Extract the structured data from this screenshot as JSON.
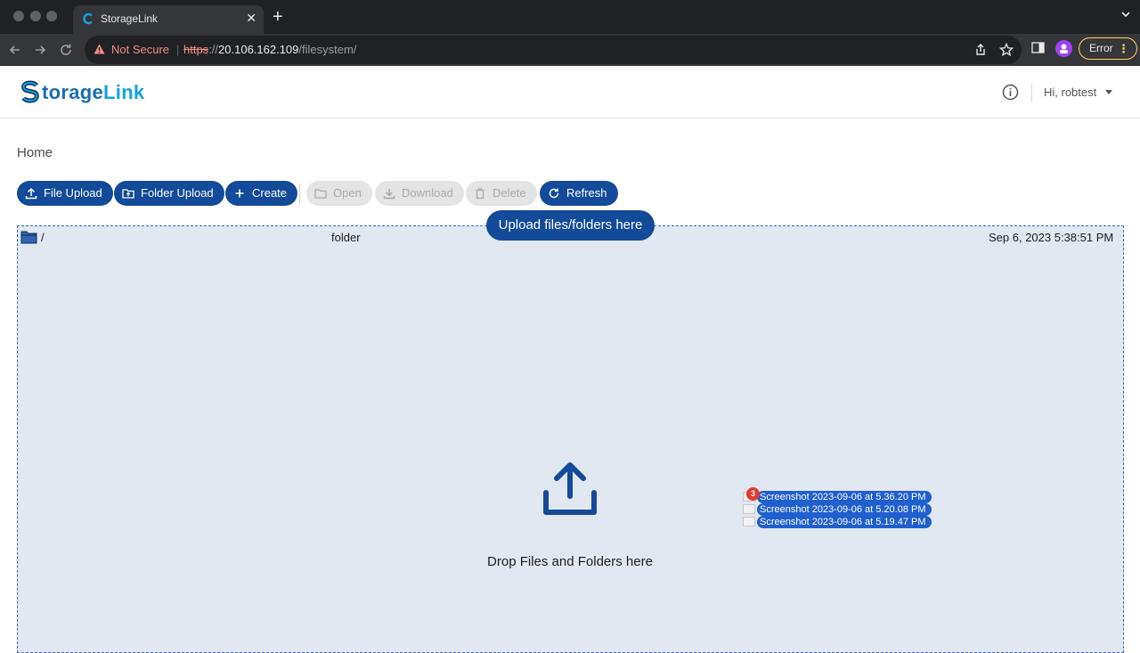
{
  "browser": {
    "tab_title": "StorageLink",
    "security_label": "Not Secure",
    "url_scheme": "https",
    "url_sep": "://",
    "url_host": "20.106.162.109",
    "url_path": "/filesystem/",
    "error_label": "Error",
    "omnibox_separator": "|"
  },
  "header": {
    "logo_storage": "torage",
    "logo_link": "Link",
    "user_greeting": "Hi, robtest"
  },
  "page": {
    "title": "Home"
  },
  "toolbar": {
    "file_upload": "File Upload",
    "folder_upload": "Folder Upload",
    "create": "Create",
    "open": "Open",
    "download": "Download",
    "delete": "Delete",
    "refresh": "Refresh"
  },
  "file_list": {
    "rows": [
      {
        "name": "/",
        "type": "folder",
        "modified": "Sep 6, 2023 5:38:51 PM"
      }
    ]
  },
  "dropzone": {
    "banner": "Upload files/folders here",
    "label": "Drop Files and Folders here"
  },
  "drag": {
    "count": "3",
    "items": [
      "Screenshot 2023-09-06 at 5.36.20 PM",
      "Screenshot 2023-09-06 at 5.20.08 PM",
      "Screenshot 2023-09-06 at 5.19.47 PM"
    ]
  },
  "colors": {
    "primary": "#134a99",
    "dropzone_bg": "#e2e8f1",
    "logo_dark": "#1a6cb8",
    "logo_light": "#14a3dc",
    "warning": "#f28b82",
    "drag_highlight": "#1f5fce"
  }
}
